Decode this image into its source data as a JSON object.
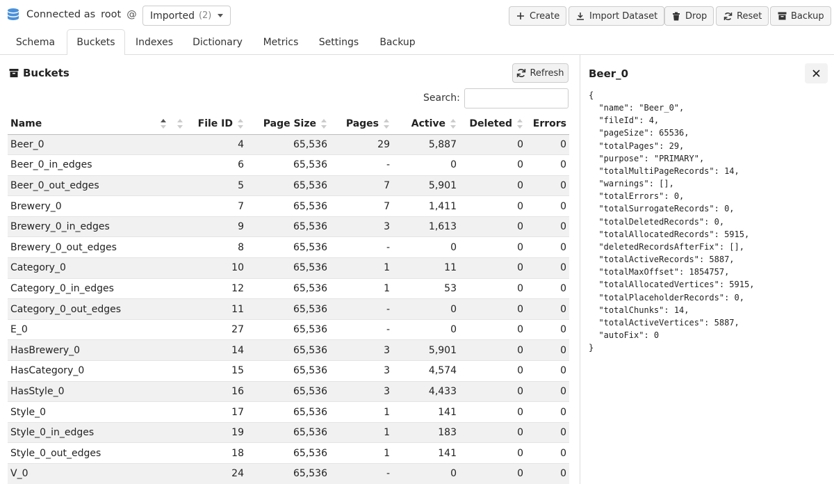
{
  "header": {
    "connected_label": "Connected as",
    "user": "root",
    "at": "@",
    "database": {
      "selected": "Imported",
      "count": "(2)"
    },
    "buttons": {
      "create": "Create",
      "import": "Import Dataset",
      "drop": "Drop",
      "reset": "Reset",
      "backup": "Backup"
    }
  },
  "tabs": [
    "Schema",
    "Buckets",
    "Indexes",
    "Dictionary",
    "Metrics",
    "Settings",
    "Backup"
  ],
  "active_tab": "Buckets",
  "buckets_panel": {
    "title": "Buckets",
    "refresh_label": "Refresh",
    "search_label": "Search:",
    "search_value": "",
    "columns": [
      "Name",
      "File ID",
      "Page Size",
      "Pages",
      "Active",
      "Deleted",
      "Errors"
    ],
    "rows": [
      [
        "Beer_0",
        "4",
        "65,536",
        "29",
        "5,887",
        "0",
        "0"
      ],
      [
        "Beer_0_in_edges",
        "6",
        "65,536",
        "-",
        "0",
        "0",
        "0"
      ],
      [
        "Beer_0_out_edges",
        "5",
        "65,536",
        "7",
        "5,901",
        "0",
        "0"
      ],
      [
        "Brewery_0",
        "7",
        "65,536",
        "7",
        "1,411",
        "0",
        "0"
      ],
      [
        "Brewery_0_in_edges",
        "9",
        "65,536",
        "3",
        "1,613",
        "0",
        "0"
      ],
      [
        "Brewery_0_out_edges",
        "8",
        "65,536",
        "-",
        "0",
        "0",
        "0"
      ],
      [
        "Category_0",
        "10",
        "65,536",
        "1",
        "11",
        "0",
        "0"
      ],
      [
        "Category_0_in_edges",
        "12",
        "65,536",
        "1",
        "53",
        "0",
        "0"
      ],
      [
        "Category_0_out_edges",
        "11",
        "65,536",
        "-",
        "0",
        "0",
        "0"
      ],
      [
        "E_0",
        "27",
        "65,536",
        "-",
        "0",
        "0",
        "0"
      ],
      [
        "HasBrewery_0",
        "14",
        "65,536",
        "3",
        "5,901",
        "0",
        "0"
      ],
      [
        "HasCategory_0",
        "15",
        "65,536",
        "3",
        "4,574",
        "0",
        "0"
      ],
      [
        "HasStyle_0",
        "16",
        "65,536",
        "3",
        "4,433",
        "0",
        "0"
      ],
      [
        "Style_0",
        "17",
        "65,536",
        "1",
        "141",
        "0",
        "0"
      ],
      [
        "Style_0_in_edges",
        "19",
        "65,536",
        "1",
        "183",
        "0",
        "0"
      ],
      [
        "Style_0_out_edges",
        "18",
        "65,536",
        "1",
        "141",
        "0",
        "0"
      ],
      [
        "V_0",
        "24",
        "65,536",
        "-",
        "0",
        "0",
        "0"
      ]
    ]
  },
  "detail_panel": {
    "title": "Beer_0",
    "json_text": "{\n  \"name\": \"Beer_0\",\n  \"fileId\": 4,\n  \"pageSize\": 65536,\n  \"totalPages\": 29,\n  \"purpose\": \"PRIMARY\",\n  \"totalMultiPageRecords\": 14,\n  \"warnings\": [],\n  \"totalErrors\": 0,\n  \"totalSurrogateRecords\": 0,\n  \"totalDeletedRecords\": 0,\n  \"totalAllocatedRecords\": 5915,\n  \"deletedRecordsAfterFix\": [],\n  \"totalActiveRecords\": 5887,\n  \"totalMaxOffset\": 1854757,\n  \"totalAllocatedVertices\": 5915,\n  \"totalPlaceholderRecords\": 0,\n  \"totalChunks\": 14,\n  \"totalActiveVertices\": 5887,\n  \"autoFix\": 0\n}"
  },
  "colors": {
    "accent_db_icon": "#4a90d9",
    "row_stripe": "#f1f1f1"
  }
}
